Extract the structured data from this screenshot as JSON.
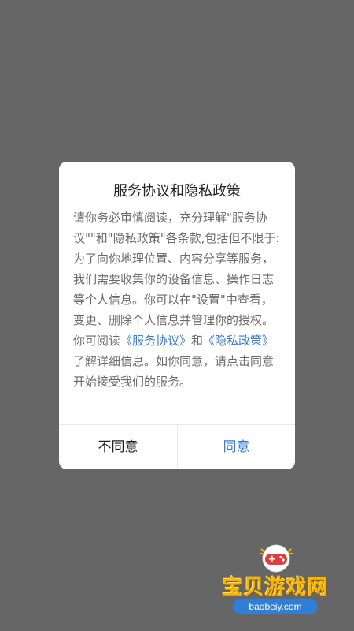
{
  "dialog": {
    "title": "服务协议和隐私政策",
    "body_pre": "请你务必审慎阅读，充分理解\"服务协议\"\"和\"隐私政策\"各条款,包括但不限于:为了向你地理位置、内容分享等服务，我们需要收集你的设备信息、操作日志等个人信息。你可以在\"设置\"中查看，变更、删除个人信息并管理你的授权。你可阅读",
    "link_service": "《服务协议》",
    "body_mid": "和",
    "link_privacy": "《隐私政策》",
    "body_post": "了解详细信息。如你同意，请点击同意开始接受我们的服务。",
    "disagree_label": "不同意",
    "agree_label": "同意"
  },
  "watermark": {
    "logo_icon": "gamepad-icon",
    "brand": "宝贝游戏网",
    "url": "baobeiy.com"
  },
  "colors": {
    "overlay": "#666666",
    "link": "#3a78d6",
    "brand_yellow": "#f7b500"
  }
}
